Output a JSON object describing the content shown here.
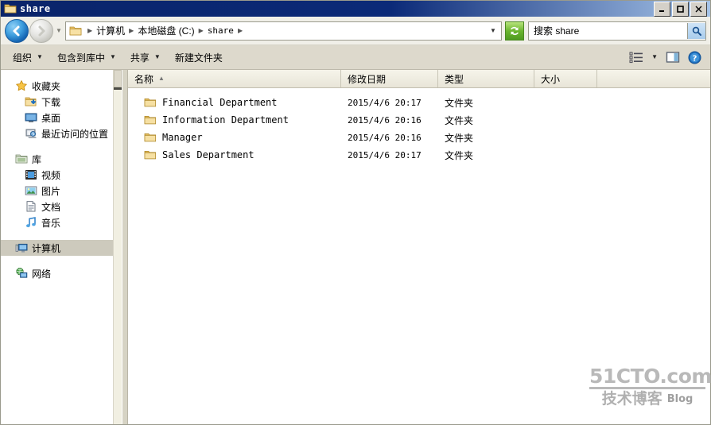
{
  "window": {
    "title": "share",
    "icon": "folder-icon",
    "controls": {
      "minimize": "_",
      "maximize": "□",
      "close": "×"
    }
  },
  "addressbar": {
    "back_icon": "back-arrow-icon",
    "forward_icon": "forward-arrow-icon",
    "history_caret": "▼",
    "path_icon": "folder-icon",
    "separator": "▶",
    "breadcrumbs": [
      {
        "label": "计算机",
        "latin": false
      },
      {
        "label": "本地磁盘 (C:)",
        "latin": false
      },
      {
        "label": "share",
        "latin": true
      }
    ],
    "dropdown_caret": "▼",
    "refresh_icon": "refresh-icon",
    "search_placeholder": "搜索 share",
    "search_icon": "magnifier-icon"
  },
  "toolbar": {
    "organize_label": "组织",
    "include_in_library_label": "包含到库中",
    "share_label": "共享",
    "new_folder_label": "新建文件夹",
    "caret": "▼",
    "view_icon": "list-view-icon",
    "view_caret": "▼",
    "preview_icon": "preview-pane-icon",
    "help_icon": "help-icon"
  },
  "sidebar": {
    "groups": [
      {
        "name": "收藏夹",
        "icon": "star-icon",
        "items": [
          {
            "label": "下载",
            "icon": "downloads-icon"
          },
          {
            "label": "桌面",
            "icon": "desktop-icon"
          },
          {
            "label": "最近访问的位置",
            "icon": "recent-places-icon"
          }
        ]
      },
      {
        "name": "库",
        "icon": "library-icon",
        "items": [
          {
            "label": "视频",
            "icon": "video-icon"
          },
          {
            "label": "图片",
            "icon": "pictures-icon"
          },
          {
            "label": "文档",
            "icon": "documents-icon"
          },
          {
            "label": "音乐",
            "icon": "music-icon"
          }
        ]
      },
      {
        "name": "计算机",
        "icon": "computer-icon",
        "selected": true,
        "items": []
      },
      {
        "name": "网络",
        "icon": "network-icon",
        "items": []
      }
    ]
  },
  "filelist": {
    "columns": [
      {
        "label": "名称",
        "sort": "▲"
      },
      {
        "label": "修改日期",
        "sort": ""
      },
      {
        "label": "类型",
        "sort": ""
      },
      {
        "label": "大小",
        "sort": ""
      }
    ],
    "rows": [
      {
        "name": "Financial Department",
        "date": "2015/4/6 20:17",
        "type": "文件夹",
        "size": "",
        "icon": "folder-icon"
      },
      {
        "name": "Information Department",
        "date": "2015/4/6 20:16",
        "type": "文件夹",
        "size": "",
        "icon": "folder-icon"
      },
      {
        "name": "Manager",
        "date": "2015/4/6 20:16",
        "type": "文件夹",
        "size": "",
        "icon": "folder-icon"
      },
      {
        "name": "Sales Department",
        "date": "2015/4/6 20:17",
        "type": "文件夹",
        "size": "",
        "icon": "folder-icon"
      }
    ]
  },
  "watermark": {
    "site": "51CTO.com",
    "subtitle": "技术博客",
    "blog": "Blog"
  },
  "colors": {
    "titlebar": "#0a246a",
    "toolbar": "#ddd9cc",
    "selection": "#cdcabd",
    "folder": "#f2d07a"
  }
}
